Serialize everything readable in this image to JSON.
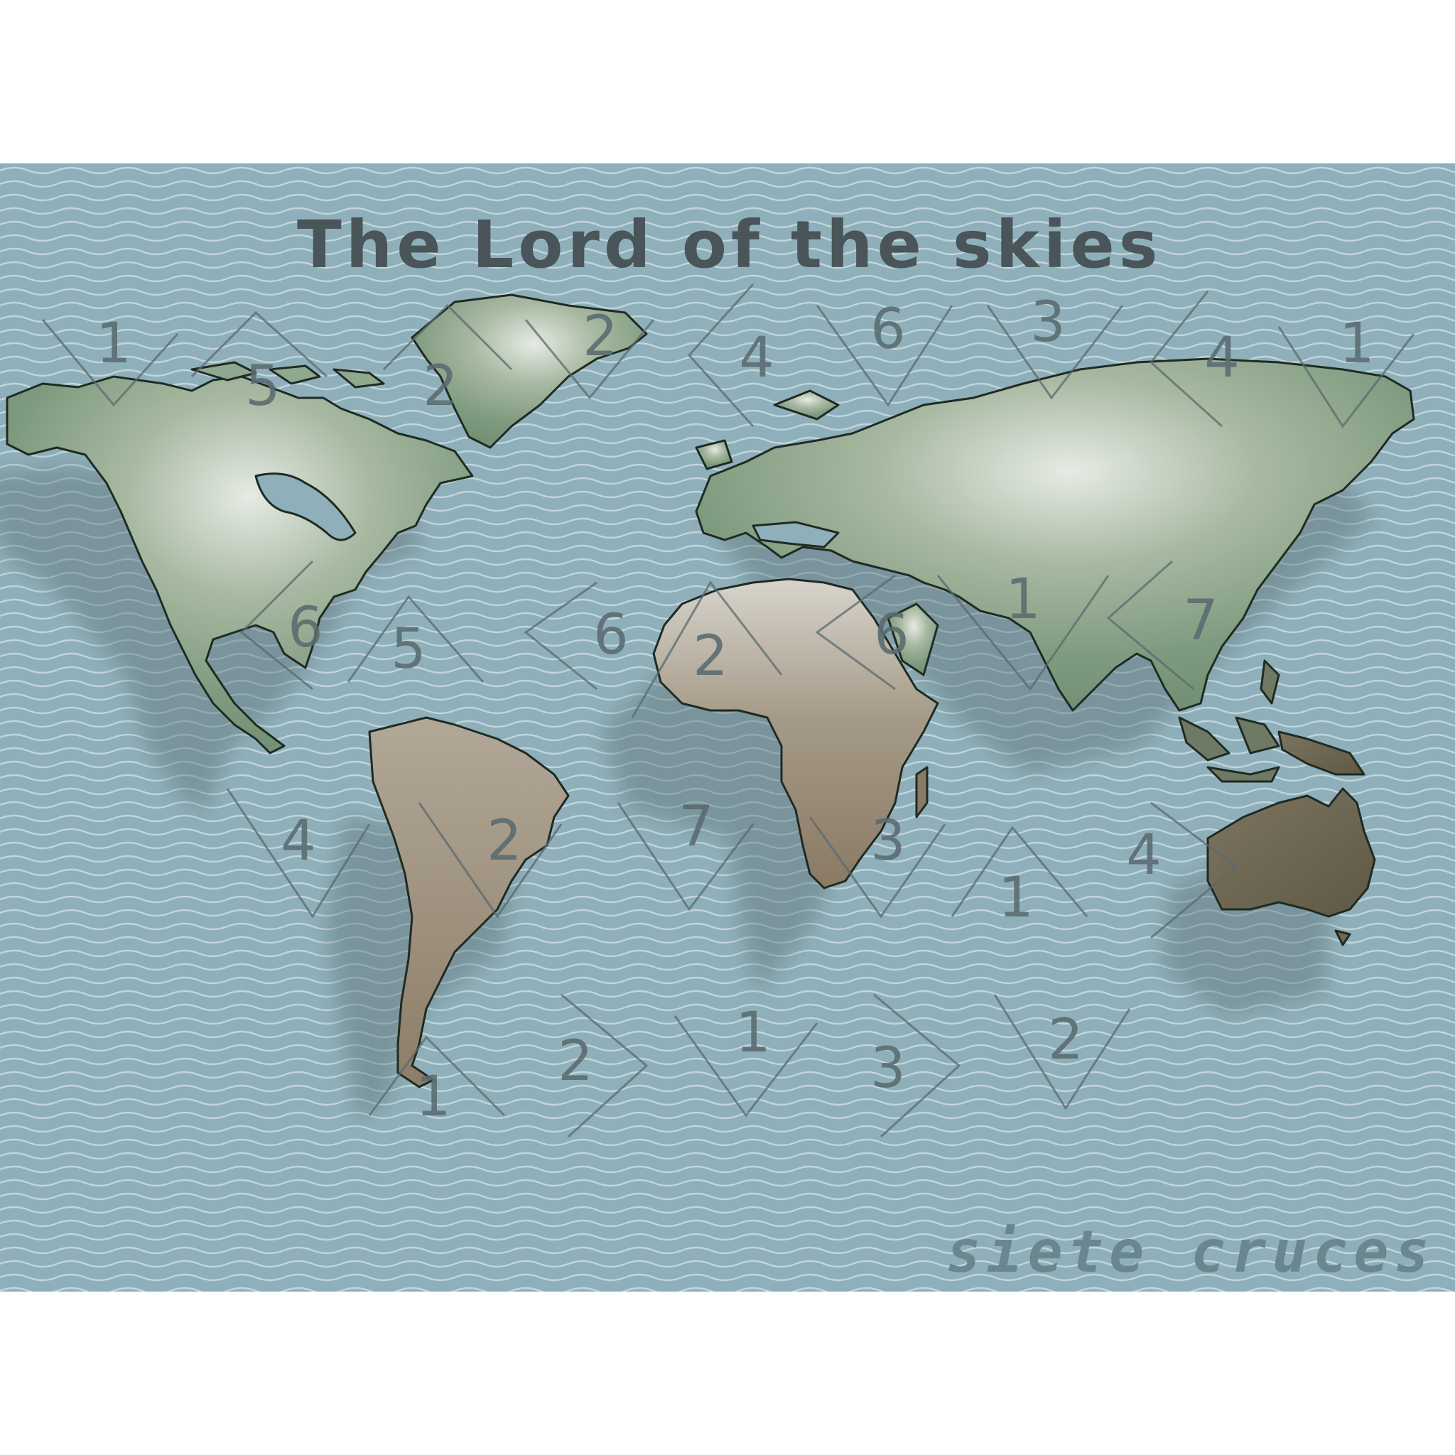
{
  "title": "The Lord of the skies",
  "signature": "siete cruces",
  "colors": {
    "ocean": "#8fb0ba",
    "wave": "#c9dde2",
    "land_green": "#7f9b7f",
    "land_light": "#e6ebe4",
    "land_brown": "#8d7d68",
    "ink": "#4a5559"
  },
  "markers": [
    {
      "label": "1"
    },
    {
      "label": "5"
    },
    {
      "label": "2"
    },
    {
      "label": "2"
    },
    {
      "label": "4"
    },
    {
      "label": "6"
    },
    {
      "label": "3"
    },
    {
      "label": "4"
    },
    {
      "label": "1"
    },
    {
      "label": "6"
    },
    {
      "label": "5"
    },
    {
      "label": "6"
    },
    {
      "label": "2"
    },
    {
      "label": "6"
    },
    {
      "label": "1"
    },
    {
      "label": "7"
    },
    {
      "label": "4"
    },
    {
      "label": "2"
    },
    {
      "label": "7"
    },
    {
      "label": "3"
    },
    {
      "label": "1"
    },
    {
      "label": "4"
    },
    {
      "label": "1"
    },
    {
      "label": "2"
    },
    {
      "label": "1"
    },
    {
      "label": "3"
    },
    {
      "label": "2"
    }
  ]
}
